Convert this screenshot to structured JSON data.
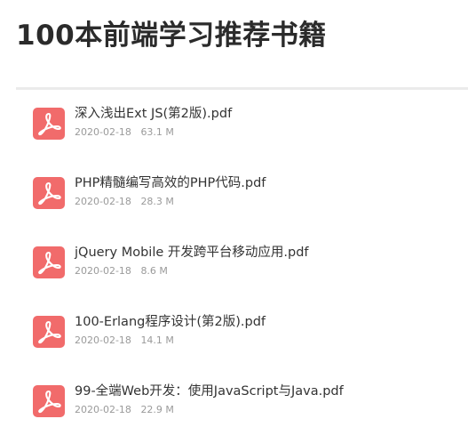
{
  "page": {
    "title": "100本前端学习推荐书籍"
  },
  "files": [
    {
      "name": "深入浅出Ext JS(第2版).pdf",
      "date": "2020-02-18",
      "size": "63.1 M",
      "icon": "pdf-icon"
    },
    {
      "name": "PHP精髓编写高效的PHP代码.pdf",
      "date": "2020-02-18",
      "size": "28.3 M",
      "icon": "pdf-icon"
    },
    {
      "name": "jQuery Mobile 开发跨平台移动应用.pdf",
      "date": "2020-02-18",
      "size": "8.6 M",
      "icon": "pdf-icon"
    },
    {
      "name": "100-Erlang程序设计(第2版).pdf",
      "date": "2020-02-18",
      "size": "14.1 M",
      "icon": "pdf-icon"
    },
    {
      "name": "99-全端Web开发：使用JavaScript与Java.pdf",
      "date": "2020-02-18",
      "size": "22.9 M",
      "icon": "pdf-icon"
    }
  ],
  "colors": {
    "pdf_icon_background": "#f16b6b",
    "title_text": "#2b2b2b",
    "meta_text": "#9a9a9a"
  }
}
